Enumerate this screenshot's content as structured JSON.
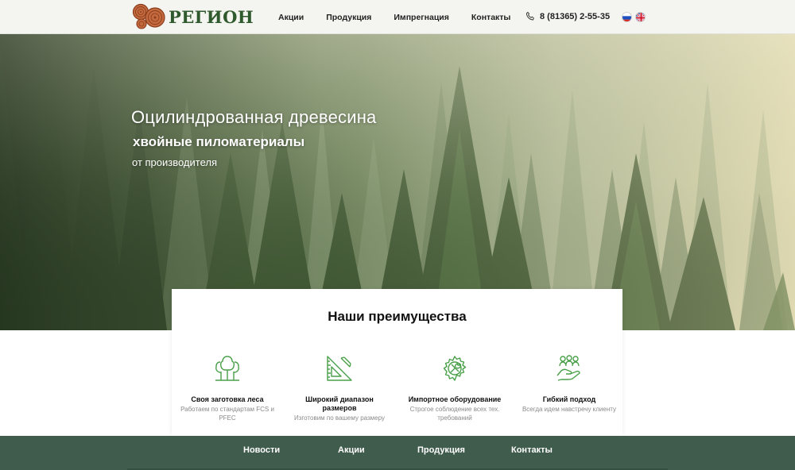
{
  "header": {
    "logo_text": "РЕГИОН",
    "nav": [
      "Акции",
      "Продукция",
      "Импрегнация",
      "Контакты"
    ],
    "phone": "8 (81365) 2-55-35"
  },
  "hero": {
    "line1": "Оцилиндрованная древесина",
    "line2": "хвойные пиломатериалы",
    "line3": "от производителя"
  },
  "advantages": {
    "title": "Наши преимущества",
    "items": [
      {
        "icon": "trees-icon",
        "title": "Своя заготовка леса",
        "desc": "Работаем по стандартам FCS и PFEC"
      },
      {
        "icon": "ruler-triangle-icon",
        "title": "Широкий диапазон размеров",
        "desc": "Изготовим по вашему размеру"
      },
      {
        "icon": "gear-tools-icon",
        "title": "Импортное оборудование",
        "desc": "Строгое соблюдение всех тех. требований"
      },
      {
        "icon": "handshake-icon",
        "title": "Гибкий подход",
        "desc": "Всегда идем навстречу клиенту"
      }
    ]
  },
  "footer": {
    "nav": [
      "Новости",
      "Акции",
      "Продукция",
      "Контакты"
    ]
  },
  "colors": {
    "brand_green": "#2f5a2d",
    "accent_green": "#4aa04a",
    "logo_brown": "#a0502e",
    "footer_bg": "#3f5c4c"
  }
}
